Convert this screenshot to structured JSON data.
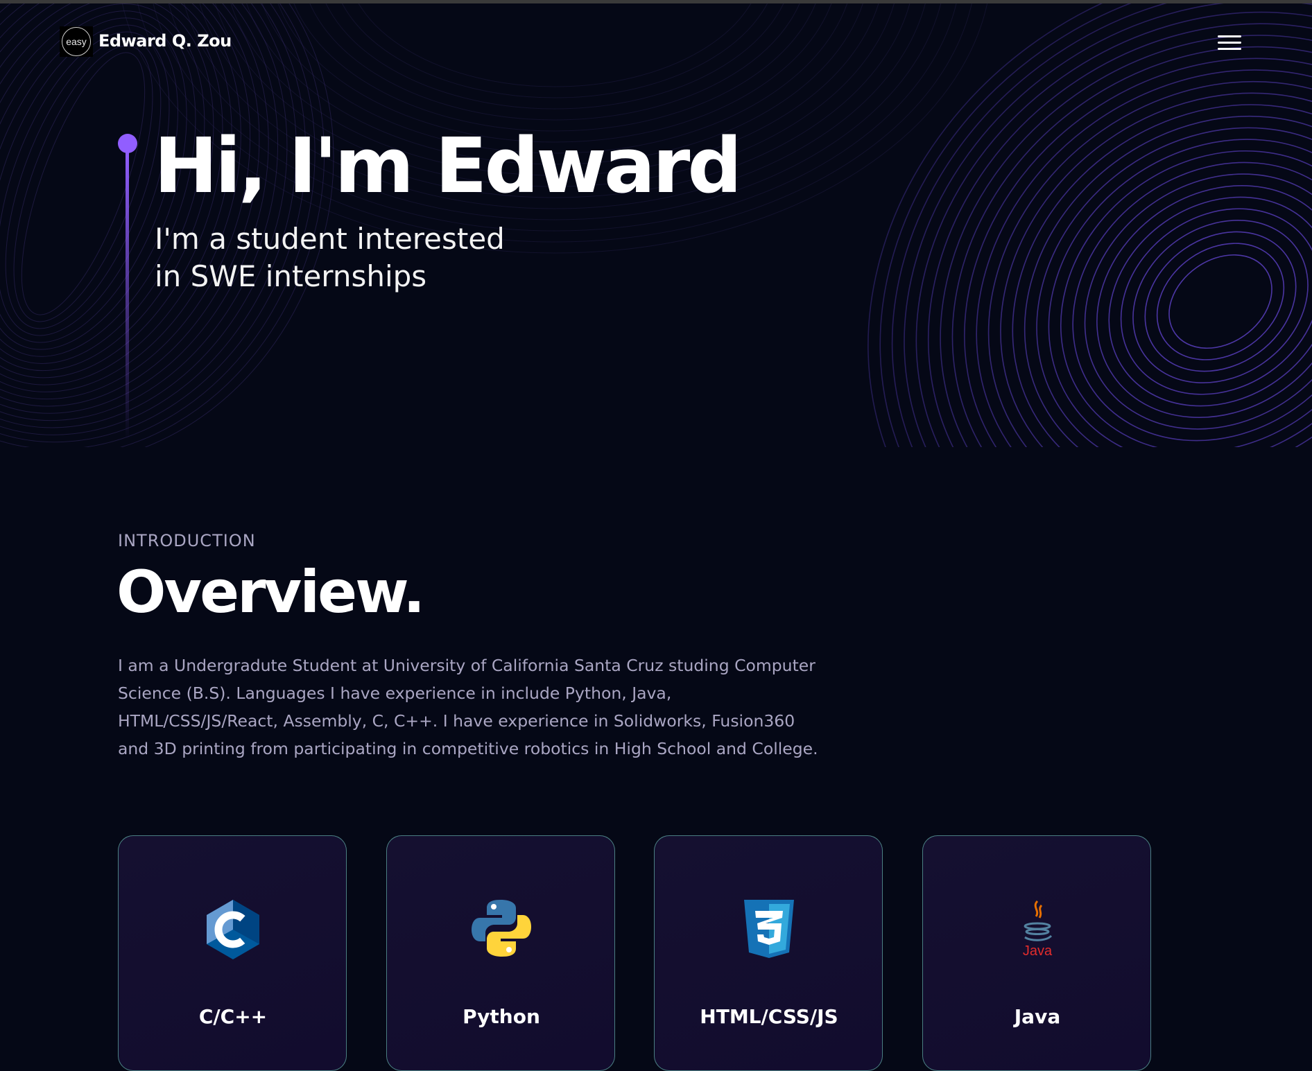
{
  "navbar": {
    "logo_text": "easy",
    "site_name": "Edward Q. Zou",
    "menu_icon": "hamburger-menu-icon"
  },
  "hero": {
    "title": "Hi, I'm Edward",
    "subtitle_line1": "I'm a student interested",
    "subtitle_line2": "in SWE internships"
  },
  "overview": {
    "label": "INTRODUCTION",
    "title": "Overview.",
    "text": "I am a Undergradute Student at University of California Santa Cruz studing Computer Science (B.S). Languages I have experience in include Python, Java, HTML/CSS/JS/React, Assembly, C, C++. I have experience in Solidworks, Fusion360 and 3D printing from participating in competitive robotics in High School and College."
  },
  "skills": [
    {
      "label": "C/C++",
      "icon": "c-plus-plus-icon"
    },
    {
      "label": "Python",
      "icon": "python-icon"
    },
    {
      "label": "HTML/CSS/JS",
      "icon": "css3-icon"
    },
    {
      "label": "Java",
      "icon": "java-icon",
      "icon_text": "Java"
    }
  ],
  "colors": {
    "background": "#050816",
    "accent": "#915eff",
    "secondary_text": "#aaa6c3",
    "card_background": "#151030"
  }
}
